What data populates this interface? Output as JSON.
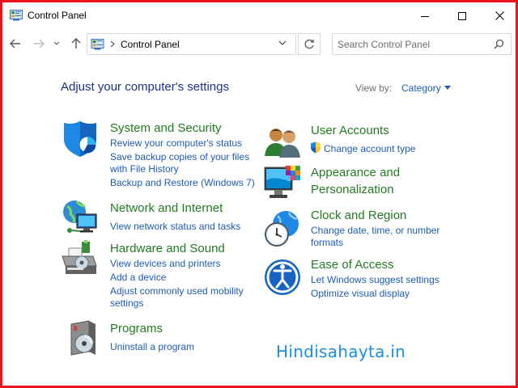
{
  "window": {
    "title": "Control Panel"
  },
  "address_bar": {
    "location": "Control Panel"
  },
  "search": {
    "placeholder": "Search Control Panel"
  },
  "main": {
    "heading": "Adjust your computer's settings",
    "view_by_label": "View by:",
    "view_by_value": "Category"
  },
  "categories": {
    "system_security": {
      "title": "System and Security",
      "links": [
        "Review your computer's status",
        "Save backup copies of your files",
        "with File History",
        "Backup and Restore (Windows 7)"
      ]
    },
    "network_internet": {
      "title": "Network and Internet",
      "links": [
        "View network status and tasks"
      ]
    },
    "hardware_sound": {
      "title": "Hardware and Sound",
      "links": [
        "View devices and printers",
        "Add a device",
        "Adjust commonly used mobility",
        "settings"
      ]
    },
    "programs": {
      "title": "Programs",
      "links": [
        "Uninstall a program"
      ]
    },
    "user_accounts": {
      "title": "User Accounts",
      "links": [
        "Change account type"
      ]
    },
    "appearance": {
      "title_line1": "Appearance and",
      "title_line2": "Personalization"
    },
    "clock_region": {
      "title": "Clock and Region",
      "links": [
        "Change date, time, or number",
        "formats"
      ]
    },
    "ease_access": {
      "title": "Ease of Access",
      "links": [
        "Let Windows suggest settings",
        "Optimize visual display"
      ]
    }
  },
  "watermark": "Hindisahayta.in",
  "colors": {
    "frame_border": "#e8141b",
    "heading": "#1e3287",
    "category_title": "#237a22",
    "link": "#1e5cb3"
  }
}
